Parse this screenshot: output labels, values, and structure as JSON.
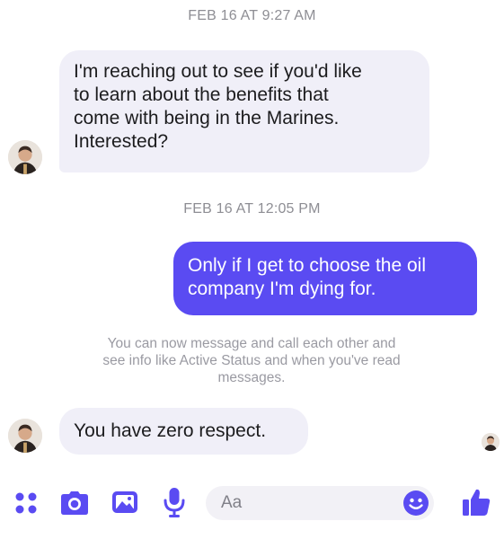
{
  "conversation": {
    "timestamps": [
      "FEB 16 AT 9:27 AM",
      "FEB 16 AT 12:05 PM"
    ],
    "messages": [
      {
        "direction": "incoming",
        "lines": [
          "I'm reaching out to see if you'd like",
          "to learn about the benefits that",
          "come with being in the Marines.",
          "Interested?"
        ]
      },
      {
        "direction": "outgoing",
        "lines": [
          "Only if I get to choose the oil",
          "company I'm dying for."
        ]
      },
      {
        "direction": "incoming",
        "lines": [
          "You have zero respect."
        ]
      }
    ],
    "system_note": {
      "lines": [
        "You can now message and call each other and",
        "see info like Active Status and when you've read",
        "messages."
      ]
    }
  },
  "composer": {
    "placeholder": "Aa",
    "icons": [
      "menu-dots-icon",
      "camera-icon",
      "photo-icon",
      "microphone-icon",
      "emoji-icon",
      "thumbs-up-icon"
    ]
  },
  "colors": {
    "accent": "#5a4bf2",
    "incoming_bubble": "#f0eff8",
    "timestamp_text": "#8e8e94"
  }
}
